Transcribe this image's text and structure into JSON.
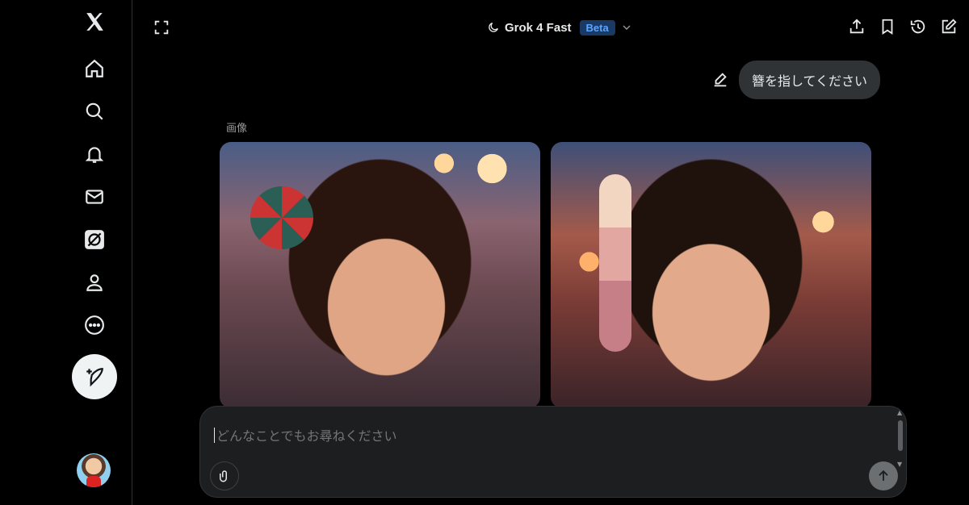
{
  "sidebar": {
    "items": [
      {
        "name": "x-logo-icon",
        "label": "X"
      },
      {
        "name": "home-icon",
        "label": "Home"
      },
      {
        "name": "search-icon",
        "label": "Explore"
      },
      {
        "name": "bell-icon",
        "label": "Notifications"
      },
      {
        "name": "mail-icon",
        "label": "Messages"
      },
      {
        "name": "grok-icon",
        "label": "Grok"
      },
      {
        "name": "person-icon",
        "label": "Profile"
      },
      {
        "name": "more-icon",
        "label": "More"
      }
    ],
    "compose_icon": "feather-plus-icon",
    "avatar_icon": "avatar"
  },
  "header": {
    "model_name": "Grok 4 Fast",
    "badge": "Beta",
    "actions": [
      "share-icon",
      "bookmark-icon",
      "history-icon",
      "new-chat-icon"
    ]
  },
  "conversation": {
    "user_message": "簪を指してください",
    "images_label": "画像"
  },
  "composer": {
    "placeholder": "どんなことでもお尋ねください",
    "value": ""
  },
  "colors": {
    "background": "#000000",
    "text": "#e7e9ea",
    "bubble": "#2f3336",
    "badge_bg": "#1a3a66",
    "badge_text": "#5ba4ff",
    "composer_bg": "#1d1e20"
  }
}
